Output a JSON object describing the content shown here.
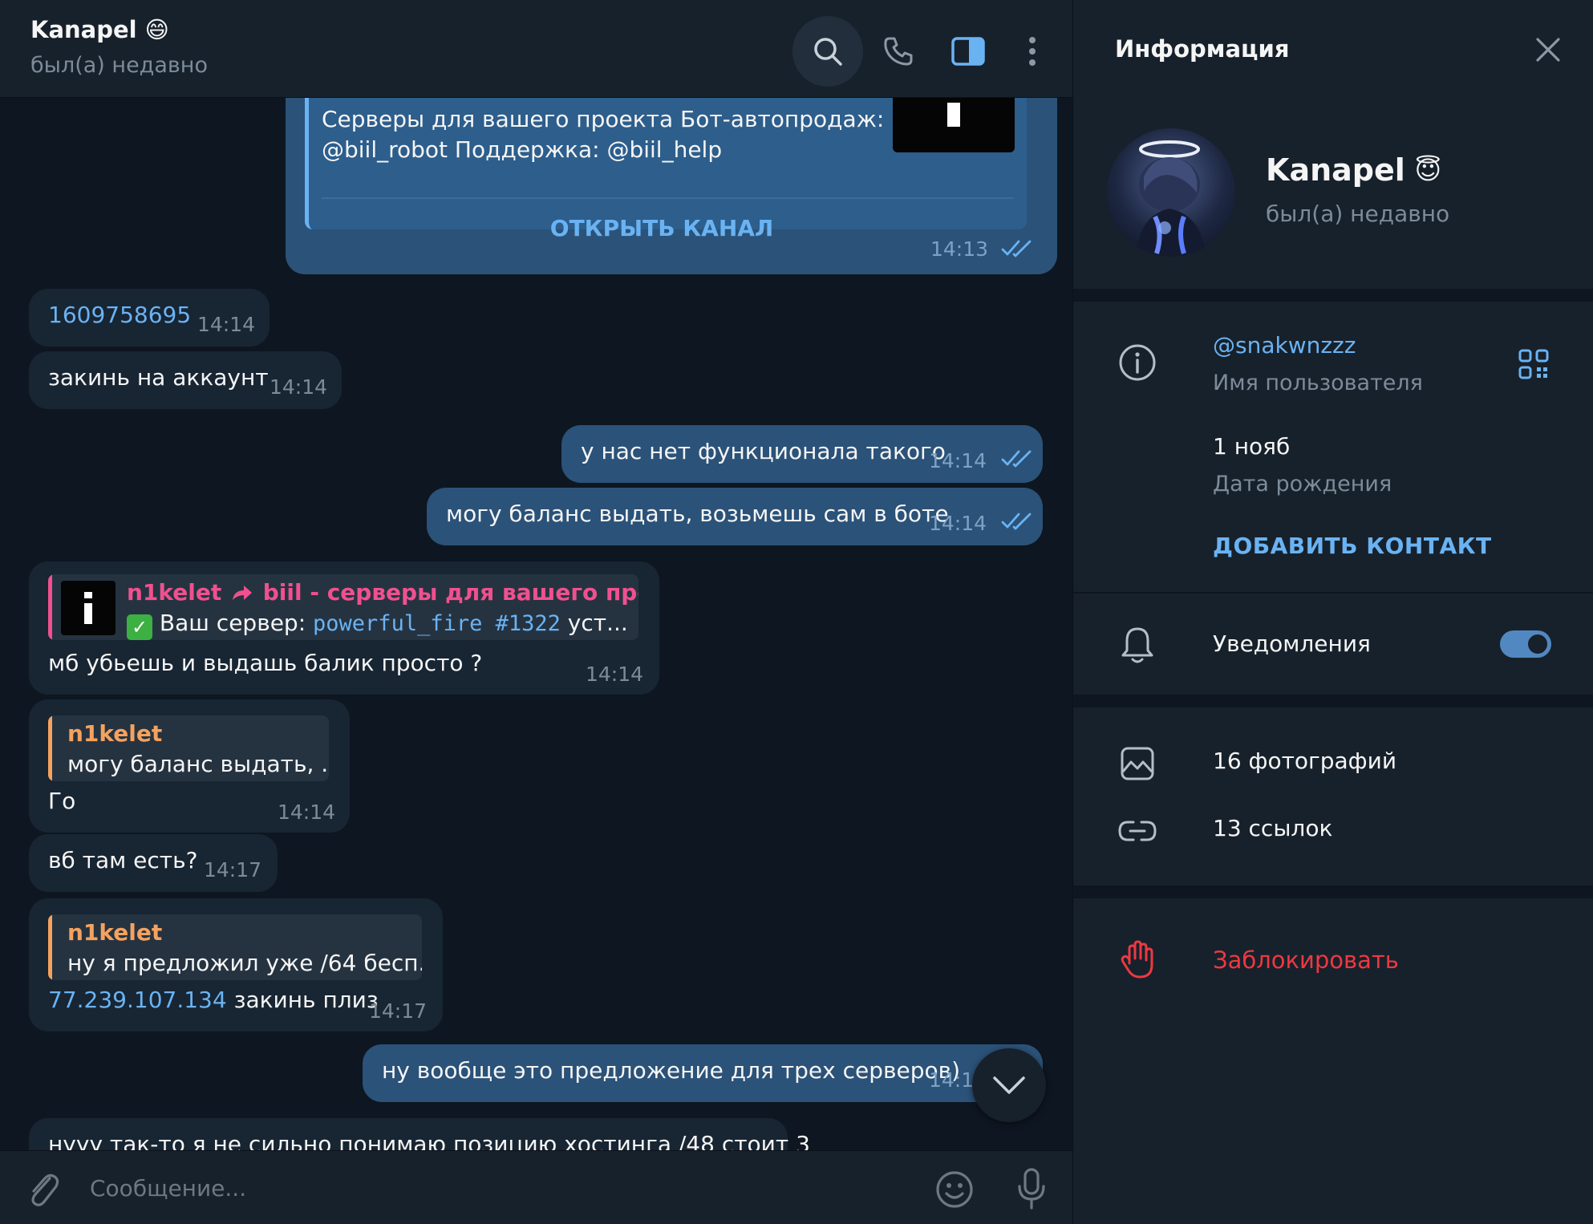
{
  "chat": {
    "title": "Kanapel",
    "title_emoji": "😄",
    "status": "был(а) недавно"
  },
  "header_icons": [
    "search-icon",
    "phone-icon",
    "sidebar-toggle-icon",
    "more-icon"
  ],
  "messages": {
    "channel_card": {
      "description_line1": "Серверы для вашего проекта Бот-автопродаж:",
      "description_line2": "@biil_robot Поддержка: @biil_help",
      "open_button": "ОТКРЫТЬ КАНАЛ",
      "time": "14:13"
    },
    "m1": {
      "text": "1609758695",
      "time": "14:14"
    },
    "m2": {
      "text": "закинь на аккаунт",
      "time": "14:14"
    },
    "m3": {
      "text": "у нас нет функционала такого",
      "time": "14:14"
    },
    "m4": {
      "text": "могу баланс выдать, возьмешь сам в боте",
      "time": "14:14"
    },
    "m5": {
      "reply_name": "n1kelet",
      "reply_forward": "biil - серверы для вашего проекта",
      "reply_prefix": "Ваш сервер: ",
      "reply_code": "powerful_fire #1322",
      "reply_suffix": " уст...",
      "text": "мб убьешь и выдашь балик просто ?",
      "time": "14:14"
    },
    "m6": {
      "reply_name": "n1kelet",
      "reply_text": "могу баланс выдать, ...",
      "text": "Го",
      "time": "14:14"
    },
    "m7": {
      "text": "вб там есть?",
      "time": "14:17"
    },
    "m8": {
      "reply_name": "n1kelet",
      "reply_text": "ну я предложил уже /64 бесп...",
      "link": "77.239.107.134",
      "text": " закинь плиз",
      "time": "14:17"
    },
    "m9": {
      "text": "ну вообще это предложение для трех серверов)",
      "time": "14:1"
    },
    "m10": {
      "text": "нууу так-то я не сильно понимаю позицию хостинга /48 стоит 3"
    }
  },
  "composer": {
    "placeholder": "Сообщение..."
  },
  "info_panel": {
    "title": "Информация",
    "name": "Kanapel",
    "name_emoji": "😇",
    "status": "был(а) недавно",
    "username": "@snakwnzzz",
    "username_label": "Имя пользователя",
    "birthday": "1 нояб",
    "birthday_label": "Дата рождения",
    "add_contact": "ДОБАВИТЬ КОНТАКТ",
    "notifications": "Уведомления",
    "notifications_on": true,
    "photos": "16 фотографий",
    "links": "13 ссылок",
    "block": "Заблокировать"
  },
  "colors": {
    "background": "#0e1621",
    "panel": "#17212b",
    "bubble_in": "#182533",
    "bubble_out": "#2b5278",
    "accent": "#6ab3f3",
    "danger": "#ec3942",
    "reply_pink": "#f0508f",
    "reply_orange": "#f4a25e"
  }
}
